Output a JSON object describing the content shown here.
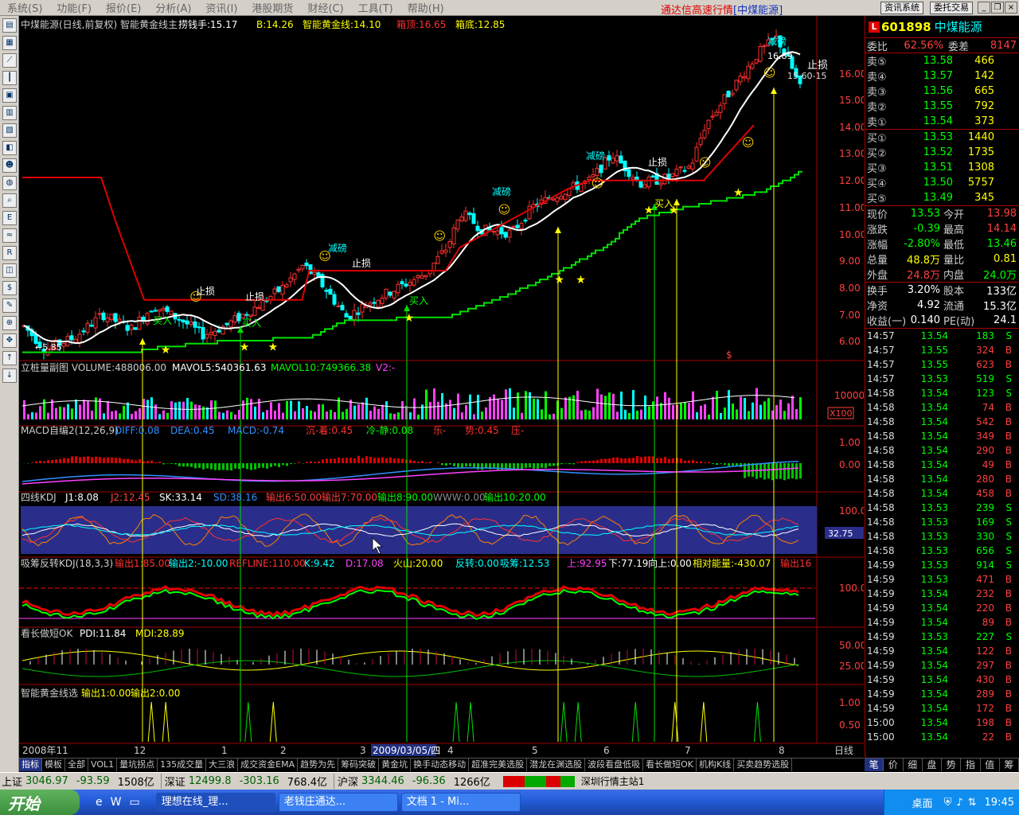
{
  "menu": {
    "items": [
      "系统(S)",
      "功能(F)",
      "报价(E)",
      "分析(A)",
      "资讯(I)",
      "港股期货",
      "财经(C)",
      "工具(T)",
      "帮助(H)"
    ],
    "app_title": "通达信高速行情",
    "stock_title": "[中煤能源]",
    "btn_news": "资讯系统",
    "btn_trade": "委托交易"
  },
  "chart_header": {
    "main": "中煤能源(日线,前复权) 智能黄金线主",
    "lqs": "捞钱手:15.17",
    "b": "B:14.26",
    "gold": "智能黄金线:14.10",
    "top": "箱顶:16.65",
    "bottom": "箱底:12.85"
  },
  "main_labels": {
    "low": "←5.85",
    "high": "16.89",
    "stop_range": "15.60-15",
    "stop_loss": "止损",
    "reduce": "减磅",
    "buy": "买入",
    "s_mark": "$"
  },
  "price_axis": [
    "16.00",
    "15.00",
    "14.00",
    "13.00",
    "12.00",
    "11.00",
    "10.00",
    "9.00",
    "8.00",
    "7.00",
    "6.00"
  ],
  "vol_header": {
    "name": "立桩量副图 VOLUME:488006.00",
    "m5": "MAVOL5:540361.63",
    "m10": "MAVOL10:749366.38",
    "v2": "V2:-"
  },
  "vol_axis": [
    "10000",
    "X100"
  ],
  "macd_header": {
    "name": "MACD自编2(12,26,9)",
    "diff": "DIFF:0.08",
    "dea": "DEA:0.45",
    "macd": "MACD:-0.74",
    "t1": "沉-着:0.45",
    "t2": "冷-静:0.08",
    "t3": "乐-",
    "t4": "势:0.45",
    "t5": "压-"
  },
  "macd_axis": [
    "1.00",
    "0.00"
  ],
  "kdj_header": {
    "name": "四线KDJ",
    "j1": "J1:8.08",
    "j2": "J2:12.45",
    "sk": "SK:33.14",
    "sd": "SD:38.16",
    "o6": "输出6:50.00",
    "o7": "输出7:70.00",
    "o8": "输出8:90.00",
    "www": "WWW:0.00",
    "o10": "输出10:20.00"
  },
  "kdj_axis": [
    "100.0",
    "32.75"
  ],
  "xc_header": {
    "name": "吸筹反转KDJ(18,3,3)",
    "o1": "输出1:85.00",
    "o2": "输出2:-10.00",
    "ref": "REFLINE:110.00",
    "k": "K:9.42",
    "d": "D:17.08",
    "hs": "火山:20.00",
    "fz": "反转:0.00",
    "xc": "吸筹:12.53",
    "up": "上:92.95",
    "down": "下:77.19",
    "xs": "向上:0.00",
    "xd": "相对能量:-430.07",
    "o16": "输出16"
  },
  "xc_axis": [
    "100.0"
  ],
  "kz_header": {
    "name": "看长做短OK",
    "pdi": "PDI:11.84",
    "mdi": "MDI:28.89"
  },
  "kz_axis": [
    "50.00",
    "25.00"
  ],
  "zn_header": {
    "name": "智能黄金线选",
    "o1": "输出1:0.00",
    "o2": "输出2:0.00"
  },
  "zn_axis": [
    "1.00",
    "0.50"
  ],
  "date_axis": {
    "labels": [
      "2008年11",
      "12",
      "1",
      "2",
      "3",
      "2009/03/05/四",
      "4",
      "5",
      "6",
      "7",
      "8"
    ],
    "period": "日线"
  },
  "tabs": [
    "指标",
    "模板",
    "全部",
    "VOL1",
    "量坑拐点",
    "135成交量",
    "大三浪",
    "成交资金EMA",
    "趋势为先",
    "筹码突破",
    "黄金坑",
    "换手动态移动",
    "超准完美选股",
    "潜龙在渊选股",
    "波段看盘低吸",
    "看长做短OK",
    "机构K线",
    "买卖趋势选股"
  ],
  "quote": {
    "badge": "L",
    "code": "601898",
    "name": "中煤能源",
    "weibi_label": "委比",
    "weibi": "62.56%",
    "weicha_label": "委差",
    "weicha": "8147",
    "sells": [
      {
        "label": "卖⑤",
        "price": "13.58",
        "vol": "466"
      },
      {
        "label": "卖④",
        "price": "13.57",
        "vol": "142"
      },
      {
        "label": "卖③",
        "price": "13.56",
        "vol": "665"
      },
      {
        "label": "卖②",
        "price": "13.55",
        "vol": "792"
      },
      {
        "label": "卖①",
        "price": "13.54",
        "vol": "373"
      }
    ],
    "buys": [
      {
        "label": "买①",
        "price": "13.53",
        "vol": "1440"
      },
      {
        "label": "买②",
        "price": "13.52",
        "vol": "1735"
      },
      {
        "label": "买③",
        "price": "13.51",
        "vol": "1308"
      },
      {
        "label": "买④",
        "price": "13.50",
        "vol": "5757"
      },
      {
        "label": "买⑤",
        "price": "13.49",
        "vol": "345"
      }
    ],
    "stats": [
      {
        "l1": "现价",
        "v1": "13.53",
        "c1": "#00ff00",
        "l2": "今开",
        "v2": "13.98",
        "c2": "#ff4040"
      },
      {
        "l1": "涨跌",
        "v1": "-0.39",
        "c1": "#00ff00",
        "l2": "最高",
        "v2": "14.14",
        "c2": "#ff4040"
      },
      {
        "l1": "涨幅",
        "v1": "-2.80%",
        "c1": "#00ff00",
        "l2": "最低",
        "v2": "13.46",
        "c2": "#00ff00"
      },
      {
        "l1": "总量",
        "v1": "48.8万",
        "c1": "#ffff00",
        "l2": "量比",
        "v2": "0.81",
        "c2": "#ffff00"
      },
      {
        "l1": "外盘",
        "v1": "24.8万",
        "c1": "#ff4040",
        "l2": "内盘",
        "v2": "24.0万",
        "c2": "#00ff00"
      }
    ],
    "stats2": [
      {
        "l1": "换手",
        "v1": "3.20%",
        "c1": "#ffffff",
        "l2": "股本",
        "v2": "133亿",
        "c2": "#ffffff"
      },
      {
        "l1": "净资",
        "v1": "4.92",
        "c1": "#ffffff",
        "l2": "流通",
        "v2": "15.3亿",
        "c2": "#ffffff"
      },
      {
        "l1": "收益(一)",
        "v1": "0.140",
        "c1": "#ffffff",
        "l2": "PE(动)",
        "v2": "24.1",
        "c2": "#ffffff"
      }
    ],
    "ticks": [
      {
        "t": "14:57",
        "p": "13.54",
        "v": "183",
        "s": "S"
      },
      {
        "t": "14:57",
        "p": "13.55",
        "v": "324",
        "s": "B"
      },
      {
        "t": "14:57",
        "p": "13.55",
        "v": "623",
        "s": "B"
      },
      {
        "t": "14:57",
        "p": "13.53",
        "v": "519",
        "s": "S"
      },
      {
        "t": "14:58",
        "p": "13.54",
        "v": "123",
        "s": "S"
      },
      {
        "t": "14:58",
        "p": "13.54",
        "v": "74",
        "s": "B"
      },
      {
        "t": "14:58",
        "p": "13.54",
        "v": "542",
        "s": "B"
      },
      {
        "t": "14:58",
        "p": "13.54",
        "v": "349",
        "s": "B"
      },
      {
        "t": "14:58",
        "p": "13.54",
        "v": "290",
        "s": "B"
      },
      {
        "t": "14:58",
        "p": "13.54",
        "v": "49",
        "s": "B"
      },
      {
        "t": "14:58",
        "p": "13.54",
        "v": "280",
        "s": "B"
      },
      {
        "t": "14:58",
        "p": "13.54",
        "v": "458",
        "s": "B"
      },
      {
        "t": "14:58",
        "p": "13.53",
        "v": "239",
        "s": "S"
      },
      {
        "t": "14:58",
        "p": "13.53",
        "v": "169",
        "s": "S"
      },
      {
        "t": "14:58",
        "p": "13.53",
        "v": "330",
        "s": "S"
      },
      {
        "t": "14:58",
        "p": "13.53",
        "v": "656",
        "s": "S"
      },
      {
        "t": "14:59",
        "p": "13.53",
        "v": "914",
        "s": "S"
      },
      {
        "t": "14:59",
        "p": "13.53",
        "v": "471",
        "s": "B"
      },
      {
        "t": "14:59",
        "p": "13.54",
        "v": "232",
        "s": "B"
      },
      {
        "t": "14:59",
        "p": "13.54",
        "v": "220",
        "s": "B"
      },
      {
        "t": "14:59",
        "p": "13.54",
        "v": "89",
        "s": "B"
      },
      {
        "t": "14:59",
        "p": "13.53",
        "v": "227",
        "s": "S"
      },
      {
        "t": "14:59",
        "p": "13.54",
        "v": "122",
        "s": "B"
      },
      {
        "t": "14:59",
        "p": "13.54",
        "v": "297",
        "s": "B"
      },
      {
        "t": "14:59",
        "p": "13.54",
        "v": "430",
        "s": "B"
      },
      {
        "t": "14:59",
        "p": "13.54",
        "v": "289",
        "s": "B"
      },
      {
        "t": "14:59",
        "p": "13.54",
        "v": "172",
        "s": "B"
      },
      {
        "t": "15:00",
        "p": "13.54",
        "v": "198",
        "s": "B"
      },
      {
        "t": "15:00",
        "p": "13.54",
        "v": "22",
        "s": "B"
      }
    ]
  },
  "right_tabs": [
    "笔",
    "价",
    "细",
    "盘",
    "势",
    "指",
    "值",
    "筹"
  ],
  "status": {
    "sh_label": "上证",
    "sh": "3046.97",
    "sh_chg": "-93.59",
    "sh_amt": "1508亿",
    "sz_label": "深证",
    "sz": "12499.8",
    "sz_chg": "-303.16",
    "sz_amt": "768.4亿",
    "hs_label": "沪深",
    "hs": "3344.46",
    "hs_chg": "-96.36",
    "hs_amt": "1266亿",
    "server": "深圳行情主站1"
  },
  "taskbar": {
    "start": "开始",
    "tasks": [
      "理想在线_理...",
      "老钱庄通达...",
      "文档 1 - Mi..."
    ],
    "desktop": "桌面",
    "clock": "19:45"
  },
  "chart_data": {
    "type": "candlestick",
    "title": "中煤能源(日线,前复权)",
    "x_range": [
      "2008年11",
      "8"
    ],
    "ylim": [
      5.8,
      17.0
    ],
    "annotations": {
      "low": 5.85,
      "high": 16.89
    },
    "month_labels": [
      "2008年11",
      "12",
      "1",
      "2",
      "3",
      "2009/03/05/四",
      "4",
      "5",
      "6",
      "7",
      "8"
    ]
  }
}
